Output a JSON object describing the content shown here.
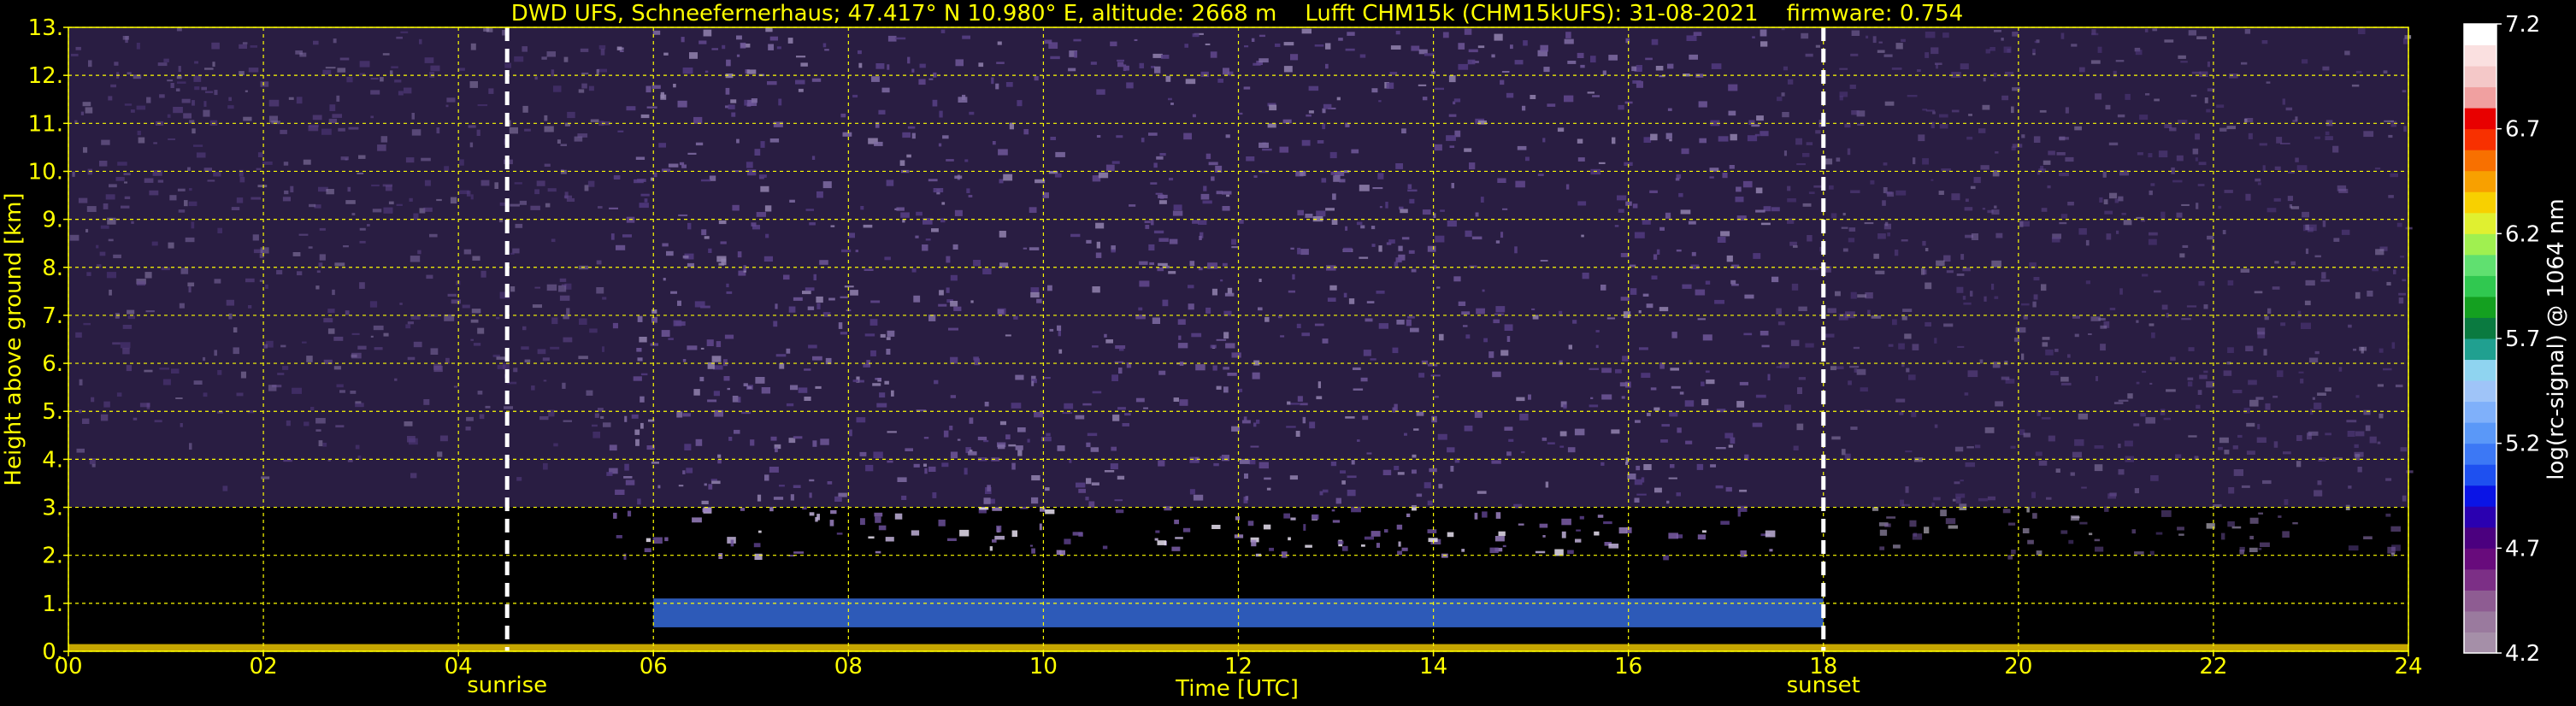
{
  "chart_data": {
    "type": "heatmap",
    "title": "DWD UFS, Schneefernerhaus; 47.417° N 10.980° E, altitude: 2668 m    Lufft CHM15k (CHM15kUFS): 31-08-2021    firmware: 0.754",
    "xlabel": "Time [UTC]",
    "ylabel": "Height above ground [km]",
    "xlim": [
      0,
      24
    ],
    "ylim": [
      0,
      13
    ],
    "x_ticks": [
      "00",
      "02",
      "04",
      "06",
      "08",
      "10",
      "12",
      "14",
      "16",
      "18",
      "20",
      "22",
      "24"
    ],
    "x_tick_values": [
      0,
      2,
      4,
      6,
      8,
      10,
      12,
      14,
      16,
      18,
      20,
      22,
      24
    ],
    "y_ticks": [
      "0.",
      "1.",
      "2.",
      "3.",
      "4.",
      "5.",
      "6.",
      "7.",
      "8.",
      "9.",
      "10.",
      "11.",
      "12.",
      "13."
    ],
    "y_tick_values": [
      0,
      1,
      2,
      3,
      4,
      5,
      6,
      7,
      8,
      9,
      10,
      11,
      12,
      13
    ],
    "grid": true,
    "markers": [
      {
        "label": "sunrise",
        "x": 4.5
      },
      {
        "label": "sunset",
        "x": 18.0
      }
    ],
    "colorbar": {
      "label": "log(rc-signal) @ 1064 nm",
      "range": [
        4.2,
        7.2
      ],
      "ticks": [
        "7.2",
        "6.7",
        "6.2",
        "5.7",
        "5.2",
        "4.7",
        "4.2"
      ],
      "tick_values": [
        7.2,
        6.7,
        6.2,
        5.7,
        5.2,
        4.7,
        4.2
      ],
      "colors": [
        "#a58fa8",
        "#9a7a9e",
        "#8e5c92",
        "#7c2f86",
        "#680b7c",
        "#4b007f",
        "#2a00b0",
        "#0a14e6",
        "#1e50f0",
        "#3c78f5",
        "#5a98f8",
        "#7fb0fa",
        "#9fc4f8",
        "#8fd4f0",
        "#20a090",
        "#0a7a40",
        "#14a020",
        "#30c850",
        "#60e070",
        "#a0f050",
        "#e0f030",
        "#f8d000",
        "#f8a000",
        "#f87000",
        "#f83000",
        "#e80000",
        "#f0a0a0",
        "#f4c8c8",
        "#fae0e0",
        "#ffffff"
      ]
    },
    "boundary_layer": [
      {
        "t0": 6.0,
        "t1": 18.0,
        "h": 0.8
      }
    ]
  }
}
